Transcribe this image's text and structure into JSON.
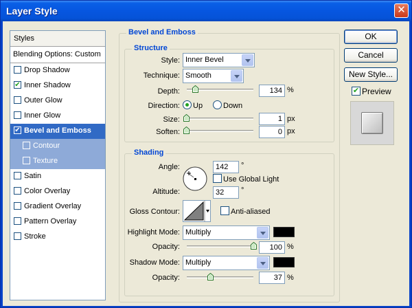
{
  "window": {
    "title": "Layer Style",
    "close_glyph": "✕"
  },
  "styles_list": {
    "header": "Styles",
    "blending": "Blending Options: Custom",
    "items": [
      {
        "label": "Drop Shadow",
        "checked": false
      },
      {
        "label": "Inner Shadow",
        "checked": true
      },
      {
        "label": "Outer Glow",
        "checked": false
      },
      {
        "label": "Inner Glow",
        "checked": false
      },
      {
        "label": "Bevel and Emboss",
        "checked": true,
        "selected": true
      },
      {
        "label": "Contour",
        "checked": false,
        "sub": true
      },
      {
        "label": "Texture",
        "checked": false,
        "sub": true
      },
      {
        "label": "Satin",
        "checked": false
      },
      {
        "label": "Color Overlay",
        "checked": false
      },
      {
        "label": "Gradient Overlay",
        "checked": false
      },
      {
        "label": "Pattern Overlay",
        "checked": false
      },
      {
        "label": "Stroke",
        "checked": false
      }
    ]
  },
  "bevel": {
    "title": "Bevel and Emboss",
    "structure": {
      "title": "Structure",
      "style_label": "Style:",
      "style_value": "Inner Bevel",
      "technique_label": "Technique:",
      "technique_value": "Smooth",
      "depth_label": "Depth:",
      "depth_value": "134",
      "depth_unit": "%",
      "depth_level": 0.134,
      "direction_label": "Direction:",
      "direction_up": "Up",
      "direction_down": "Down",
      "direction_selected": "Up",
      "size_label": "Size:",
      "size_value": "1",
      "size_unit": "px",
      "size_level": 0.0,
      "soften_label": "Soften:",
      "soften_value": "0",
      "soften_unit": "px",
      "soften_level": 0.0
    },
    "shading": {
      "title": "Shading",
      "angle_label": "Angle:",
      "angle_value": "142",
      "angle_unit": "°",
      "global_light_label": "Use Global Light",
      "global_light_checked": false,
      "altitude_label": "Altitude:",
      "altitude_value": "32",
      "altitude_unit": "°",
      "gloss_label": "Gloss Contour:",
      "anti_aliased_label": "Anti-aliased",
      "anti_aliased_checked": false,
      "highlight_label": "Highlight Mode:",
      "highlight_value": "Multiply",
      "highlight_color": "#000000",
      "highlight_opacity_label": "Opacity:",
      "highlight_opacity_value": "100",
      "highlight_opacity_unit": "%",
      "highlight_opacity_level": 1.0,
      "shadow_label": "Shadow Mode:",
      "shadow_value": "Multiply",
      "shadow_color": "#000000",
      "shadow_opacity_label": "Opacity:",
      "shadow_opacity_value": "37",
      "shadow_opacity_unit": "%",
      "shadow_opacity_level": 0.37
    }
  },
  "buttons": {
    "ok": "OK",
    "cancel": "Cancel",
    "new_style": "New Style...",
    "preview": "Preview",
    "preview_checked": true
  }
}
